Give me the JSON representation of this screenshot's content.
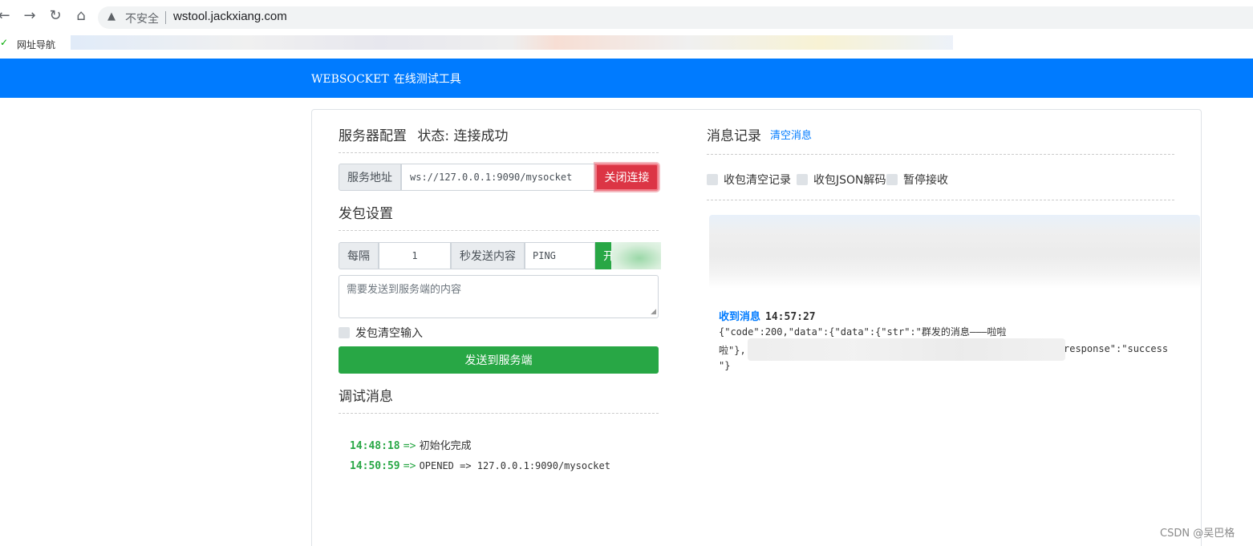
{
  "browser": {
    "insecure_label": "不安全",
    "url": "wstool.jackxiang.com",
    "bookmark_label": "网址导航"
  },
  "header": {
    "brand_main": "WEBSOCKET",
    "brand_sub": "在线测试工具"
  },
  "server": {
    "title": "服务器配置",
    "status": "状态: 连接成功",
    "addr_label": "服务地址",
    "addr_value": "ws://127.0.0.1:9090/mysocket",
    "close_button": "关闭连接"
  },
  "send_settings": {
    "title": "发包设置",
    "interval_label": "每隔",
    "interval_value": "1",
    "content_label": "秒发送内容",
    "content_value": "PING",
    "start_button": "开",
    "textarea_placeholder": "需要发送到服务端的内容",
    "clear_input_label": "发包清空输入",
    "send_button": "发送到服务端"
  },
  "debug": {
    "title": "调试消息",
    "entries": [
      {
        "time": "14:48:18",
        "arrow": "=>",
        "text": "初始化完成"
      },
      {
        "time": "14:50:59",
        "arrow": "=>",
        "text": "OPENED => 127.0.0.1:9090/mysocket"
      }
    ]
  },
  "messages": {
    "title": "消息记录",
    "clear_link": "清空消息",
    "options": [
      "收包清空记录",
      "收包JSON解码",
      "暂停接收"
    ],
    "received_label": "收到消息",
    "received_time": "14:57:27",
    "body_line1": "{\"code\":200,\"data\":{\"data\":{\"str\":\"群发的消息———啦啦",
    "body_line2a": "啦\"},",
    "body_line2b": "response\":\"success",
    "body_line3": "\"}"
  },
  "watermark": "CSDN @吴巴格"
}
